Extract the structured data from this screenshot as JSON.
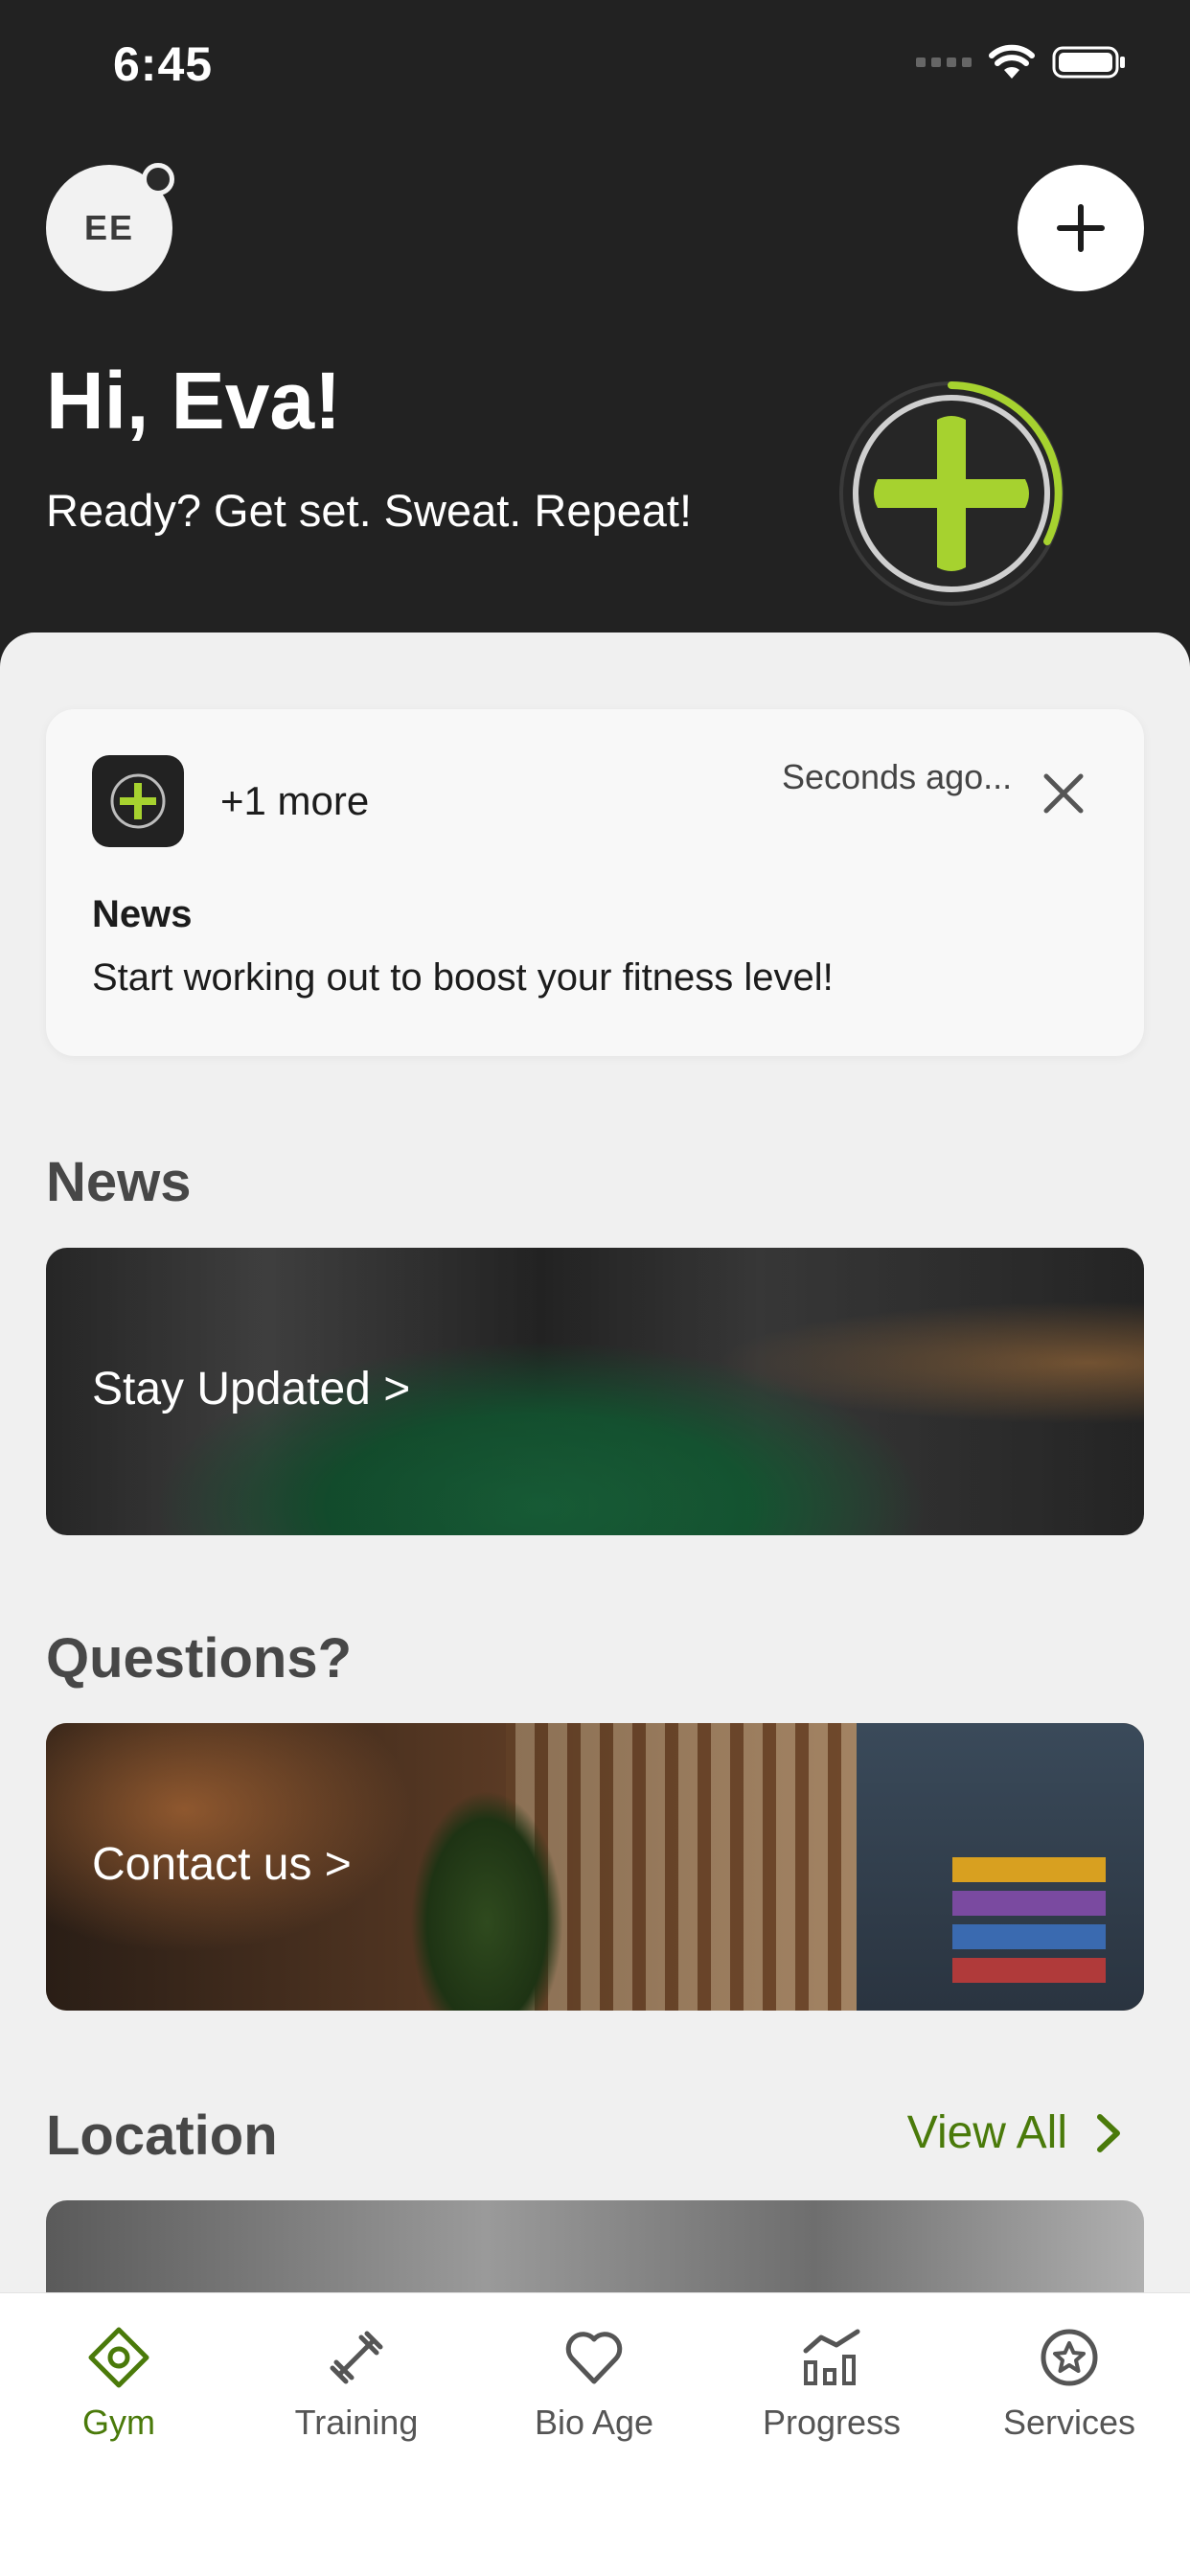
{
  "status_bar": {
    "time": "6:45"
  },
  "header": {
    "avatar_initials": "EE",
    "greeting": "Hi, Eva!",
    "tagline": "Ready? Get set. Sweat. Repeat!"
  },
  "notification": {
    "more": "+1 more",
    "time": "Seconds ago...",
    "title": "News",
    "body": "Start working out to boost your fitness level!"
  },
  "sections": {
    "news_title": "News",
    "news_card": "Stay Updated >",
    "questions_title": "Questions?",
    "questions_card": "Contact us >",
    "location_title": "Location",
    "view_all": "View All"
  },
  "tabs": [
    {
      "label": "Gym",
      "icon": "gym-icon",
      "active": true
    },
    {
      "label": "Training",
      "icon": "dumbbell-icon",
      "active": false
    },
    {
      "label": "Bio Age",
      "icon": "heart-icon",
      "active": false
    },
    {
      "label": "Progress",
      "icon": "chart-icon",
      "active": false
    },
    {
      "label": "Services",
      "icon": "star-circle-icon",
      "active": false
    }
  ],
  "colors": {
    "header_bg": "#222222",
    "accent_green": "#a6d22f",
    "active_tab": "#4a7a0a",
    "page_bg": "#f0f0f0"
  }
}
